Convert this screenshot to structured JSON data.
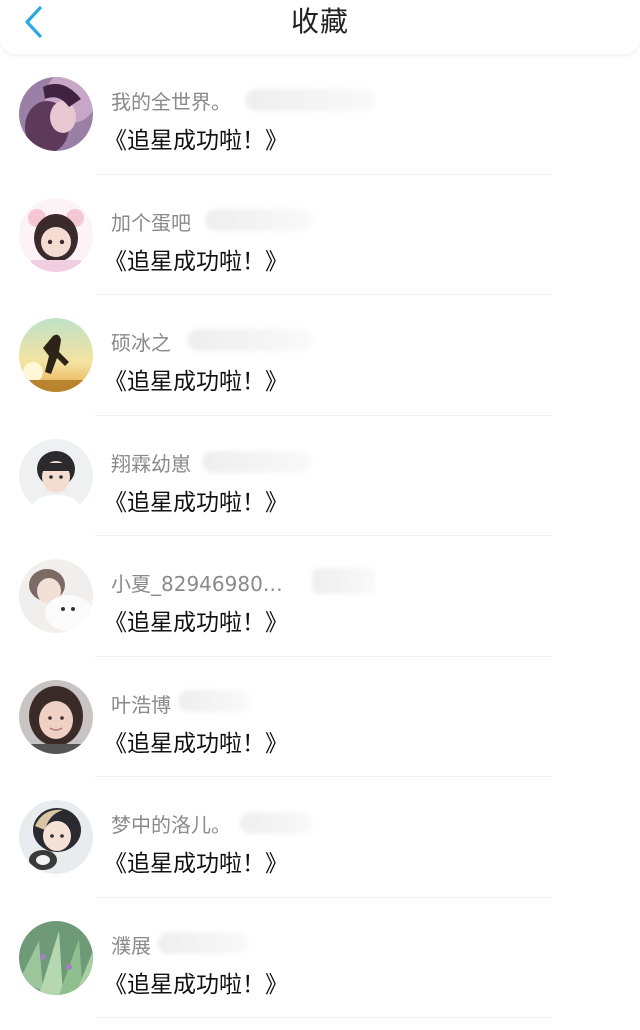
{
  "header": {
    "title": "收藏",
    "back_icon": "chevron-left-icon",
    "accent_color": "#2aa8e6"
  },
  "items": [
    {
      "name": "我的全世界。",
      "message": "《追星成功啦！》"
    },
    {
      "name": "加个蛋吧",
      "message": "《追星成功啦！》"
    },
    {
      "name": "硕冰之",
      "message": "《追星成功啦！》"
    },
    {
      "name": "翔霖幼崽",
      "message": "《追星成功啦！》"
    },
    {
      "name": "小夏_82946980…",
      "message": "《追星成功啦！》"
    },
    {
      "name": "叶浩博",
      "message": "《追星成功啦！》"
    },
    {
      "name": "梦中的洛儿。",
      "message": "《追星成功啦！》"
    },
    {
      "name": "濮展",
      "message": "《追星成功啦！》"
    }
  ]
}
